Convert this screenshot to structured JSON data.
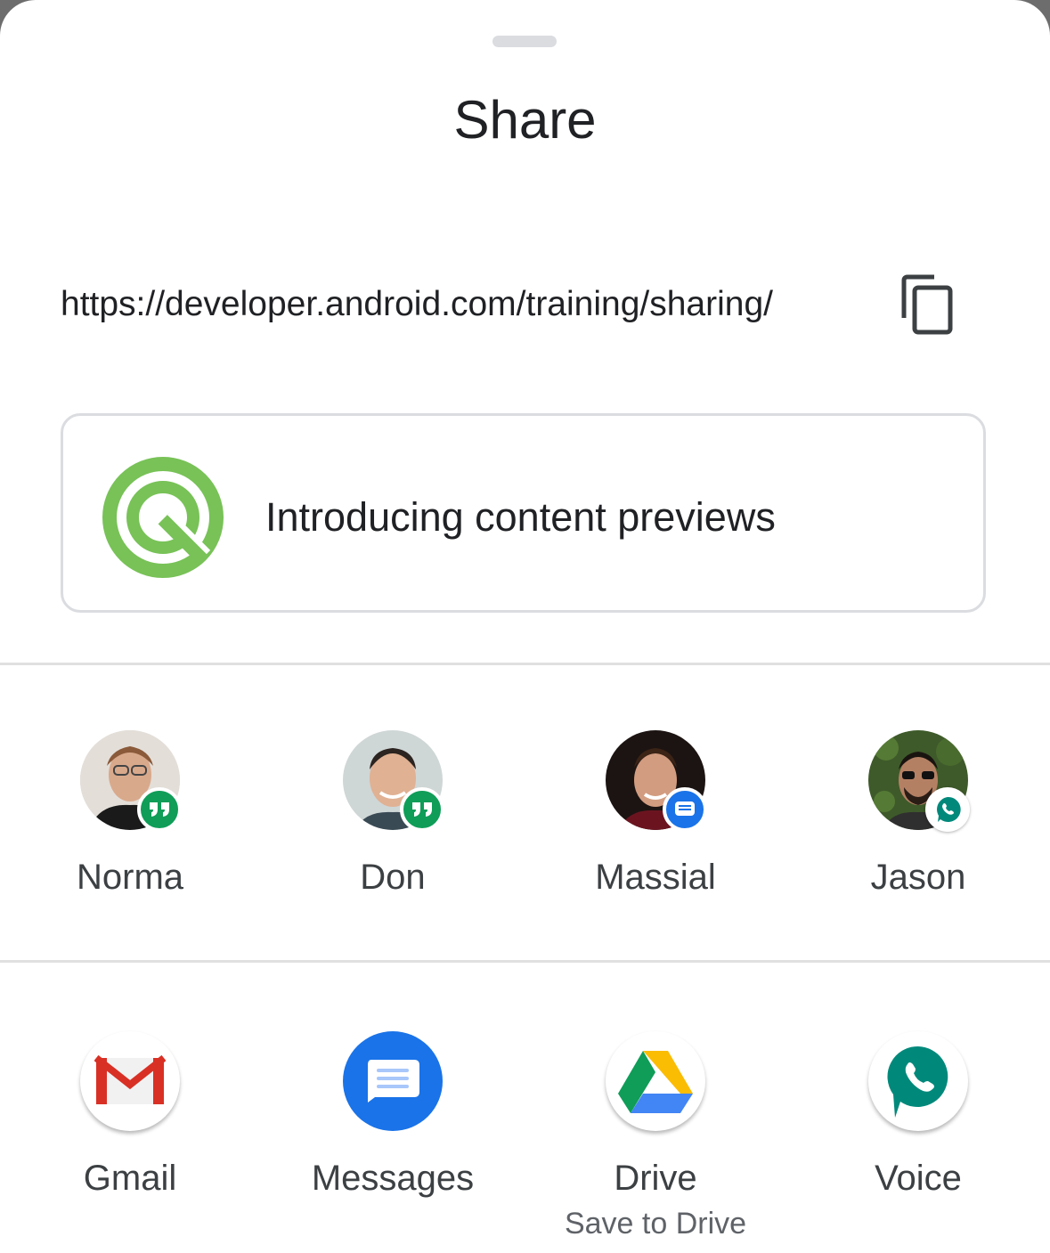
{
  "sheet": {
    "title": "Share"
  },
  "link": {
    "url": "https://developer.android.com/training/sharing/",
    "copy_icon": "copy-icon"
  },
  "preview": {
    "title": "Introducing content previews",
    "icon": "android-q-logo"
  },
  "direct_share": [
    {
      "name": "Norma",
      "badge_icon": "hangouts-icon",
      "badge_color": "#0f9d58"
    },
    {
      "name": "Don",
      "badge_icon": "hangouts-icon",
      "badge_color": "#0f9d58"
    },
    {
      "name": "Massial",
      "badge_icon": "messages-icon",
      "badge_color": "#1a73e8"
    },
    {
      "name": "Jason",
      "badge_icon": "voice-icon",
      "badge_color": "#ffffff"
    }
  ],
  "apps": [
    {
      "label": "Gmail",
      "icon": "gmail-icon",
      "sublabel": ""
    },
    {
      "label": "Messages",
      "icon": "messages-icon",
      "sublabel": ""
    },
    {
      "label": "Drive",
      "icon": "drive-icon",
      "sublabel": "Save to Drive"
    },
    {
      "label": "Voice",
      "icon": "voice-icon",
      "sublabel": ""
    }
  ],
  "colors": {
    "accent_green": "#78c257",
    "hangouts_green": "#0f9d58",
    "messages_blue": "#1a73e8",
    "voice_teal": "#00796b",
    "divider": "#e0e0e0"
  }
}
